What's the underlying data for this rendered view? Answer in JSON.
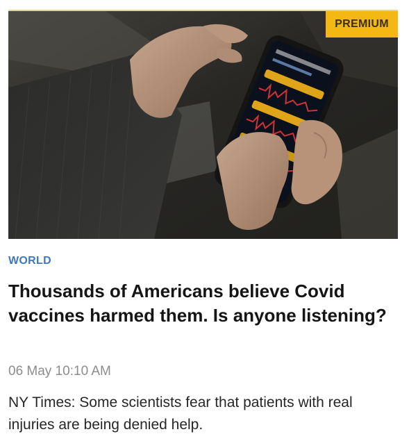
{
  "article": {
    "badge": "PREMIUM",
    "category": "WORLD",
    "title": "Thousands of Americans believe Covid vaccines harmed them. Is anyone listening?",
    "timestamp": "06 May 10:10 AM",
    "summary": "NY Times: Some scientists fear that patients with real injuries are being denied help."
  },
  "colors": {
    "badge_bg": "#f3b813",
    "category": "#3e79bd",
    "title": "#151515",
    "timestamp": "#8c8c8c",
    "summary": "#262626"
  },
  "icons": {
    "thumbnail": "photo-hands-holding-phone-heart-rhythm-app"
  }
}
